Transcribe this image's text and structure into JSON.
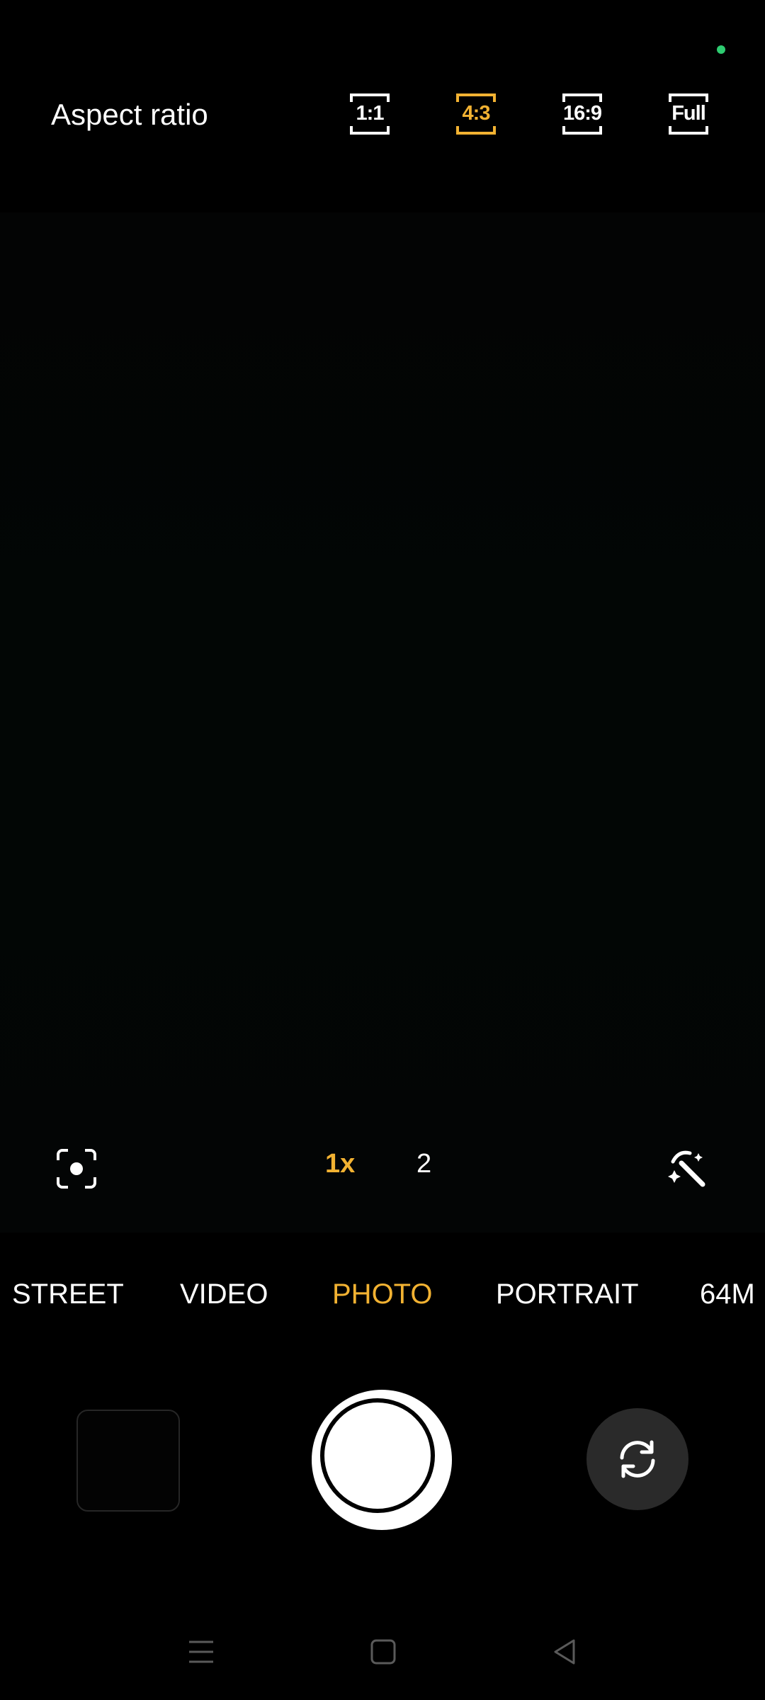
{
  "status": {
    "privacy_indicator_color": "#2ecc71"
  },
  "top_bar": {
    "title": "Aspect ratio",
    "options": [
      {
        "label": "1:1",
        "selected": false
      },
      {
        "label": "4:3",
        "selected": true
      },
      {
        "label": "16:9",
        "selected": false
      },
      {
        "label": "Full",
        "selected": false
      }
    ]
  },
  "viewfinder_controls": {
    "focus_icon": "focus-frame-icon",
    "zoom_options": [
      {
        "label": "1x",
        "selected": true
      },
      {
        "label": "2",
        "selected": false
      }
    ],
    "magic_icon": "magic-wand-icon"
  },
  "modes": [
    {
      "label": "STREET",
      "selected": false
    },
    {
      "label": "VIDEO",
      "selected": false
    },
    {
      "label": "PHOTO",
      "selected": true
    },
    {
      "label": "PORTRAIT",
      "selected": false
    },
    {
      "label": "64M",
      "selected": false
    }
  ],
  "bottom_controls": {
    "gallery_icon": "gallery-thumbnail",
    "shutter_icon": "shutter-button",
    "switch_icon": "switch-camera-icon"
  },
  "nav_bar": {
    "menu_icon": "menu-icon",
    "home_icon": "home-icon",
    "back_icon": "back-icon"
  },
  "colors": {
    "accent": "#F2B232",
    "text": "#FFFFFF",
    "background": "#000000"
  }
}
